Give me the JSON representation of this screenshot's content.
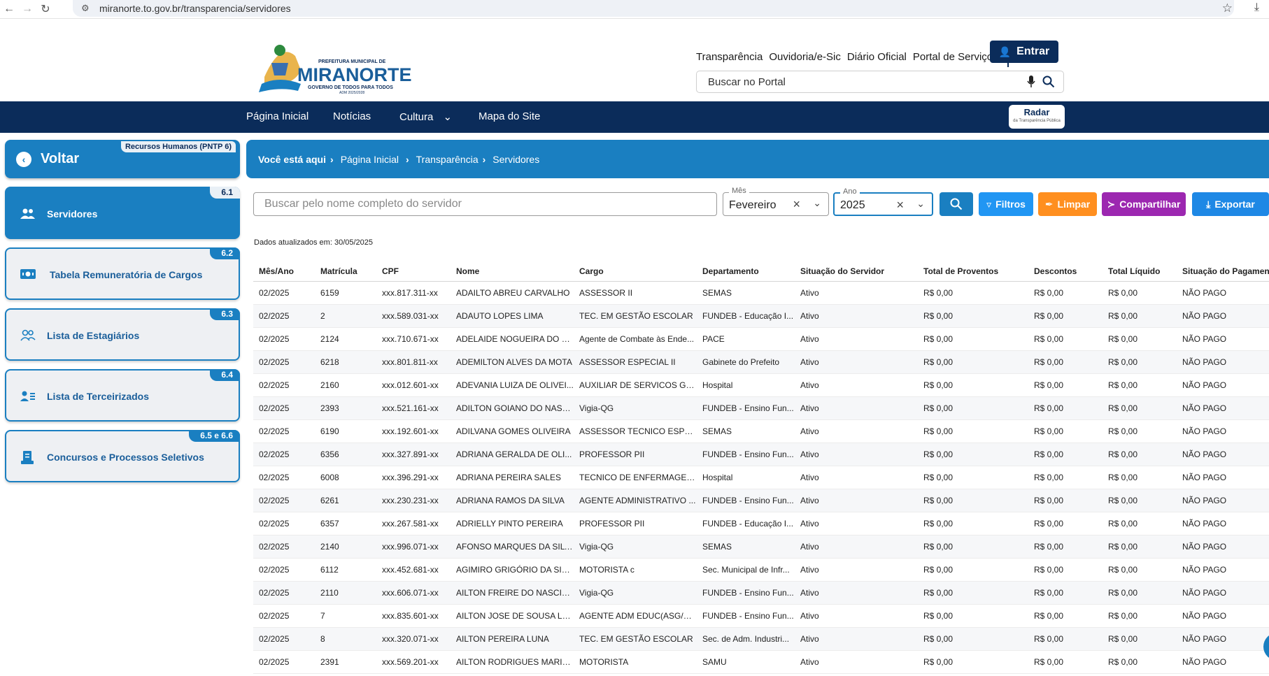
{
  "browser": {
    "url": "miranorte.to.gov.br/transparencia/servidores"
  },
  "header": {
    "logo_top": "PREFEITURA MUNICIPAL DE",
    "logo_name": "MIRANORTE",
    "logo_slogan": "GOVERNO DE TODOS PARA TODOS",
    "logo_adm": "ADM 2025/2028",
    "links": [
      "Transparência",
      "Ouvidoria/e-Sic",
      "Diário Oficial",
      "Portal de Serviços"
    ],
    "entrar_label": "Entrar",
    "search_placeholder": "Buscar no Portal"
  },
  "mainnav": {
    "items": [
      "Página Inicial",
      "Notícias",
      "Cultura",
      "Mapa do Site"
    ],
    "radar_title": "Radar",
    "radar_sub": "da Transparência Pública"
  },
  "sidebar": {
    "voltar_label": "Voltar",
    "voltar_tag": "Recursos Humanos (PNTP 6)",
    "items": [
      {
        "num": "6.1",
        "label": "Servidores",
        "active": true
      },
      {
        "num": "6.2",
        "label": "Tabela Remuneratória de Cargos",
        "active": false
      },
      {
        "num": "6.3",
        "label": "Lista de Estagiários",
        "active": false
      },
      {
        "num": "6.4",
        "label": "Lista de Terceirizados",
        "active": false
      },
      {
        "num": "6.5 e 6.6",
        "label": "Concursos e Processos Seletivos",
        "active": false
      }
    ]
  },
  "breadcrumb": {
    "prefix": "Você está aqui",
    "items": [
      "Página Inicial",
      "Transparência",
      "Servidores"
    ]
  },
  "filters": {
    "search_placeholder": "Buscar pelo nome completo do servidor",
    "mes_label": "Mês",
    "mes_value": "Fevereiro",
    "ano_label": "Ano",
    "ano_value": "2025",
    "btn_filtros": "Filtros",
    "btn_limpar": "Limpar",
    "btn_compartilhar": "Compartilhar",
    "btn_exportar": "Exportar",
    "colors": {
      "search": "#1a7fc1",
      "filtros": "#2196f3",
      "limpar": "#ff8f1f",
      "compartilhar": "#9c27b0",
      "exportar": "#1e88e5"
    }
  },
  "updated_text": "Dados atualizados em: 30/05/2025",
  "table": {
    "columns": [
      "Mês/Ano",
      "Matrícula",
      "CPF",
      "Nome",
      "Cargo",
      "Departamento",
      "Situação do Servidor",
      "Total de Proventos",
      "Descontos",
      "Total Líquido",
      "Situação do Pagamento"
    ],
    "rows": [
      [
        "02/2025",
        "6159",
        "xxx.817.311-xx",
        "ADAILTO ABREU CARVALHO",
        "ASSESSOR II",
        "SEMAS",
        "Ativo",
        "R$ 0,00",
        "R$ 0,00",
        "R$ 0,00",
        "NÃO PAGO"
      ],
      [
        "02/2025",
        "2",
        "xxx.589.031-xx",
        "ADAUTO LOPES LIMA",
        "TEC. EM GESTÃO ESCOLAR",
        "FUNDEB - Educação I...",
        "Ativo",
        "R$ 0,00",
        "R$ 0,00",
        "R$ 0,00",
        "NÃO PAGO"
      ],
      [
        "02/2025",
        "2124",
        "xxx.710.671-xx",
        "ADELAIDE NOGUEIRA DO N...",
        "Agente de Combate às Ende...",
        "PACE",
        "Ativo",
        "R$ 0,00",
        "R$ 0,00",
        "R$ 0,00",
        "NÃO PAGO"
      ],
      [
        "02/2025",
        "6218",
        "xxx.801.811-xx",
        "ADEMILTON ALVES DA MOTA",
        "ASSESSOR ESPECIAL II",
        "Gabinete do Prefeito",
        "Ativo",
        "R$ 0,00",
        "R$ 0,00",
        "R$ 0,00",
        "NÃO PAGO"
      ],
      [
        "02/2025",
        "2160",
        "xxx.012.601-xx",
        "ADEVANIA LUIZA DE OLIVEI...",
        "AUXILIAR DE SERVICOS GE...",
        "Hospital",
        "Ativo",
        "R$ 0,00",
        "R$ 0,00",
        "R$ 0,00",
        "NÃO PAGO"
      ],
      [
        "02/2025",
        "2393",
        "xxx.521.161-xx",
        "ADILTON GOIANO DO NASCI...",
        "Vigia-QG",
        "FUNDEB - Ensino Fun...",
        "Ativo",
        "R$ 0,00",
        "R$ 0,00",
        "R$ 0,00",
        "NÃO PAGO"
      ],
      [
        "02/2025",
        "6190",
        "xxx.192.601-xx",
        "ADILVANA GOMES OLIVEIRA",
        "ASSESSOR TECNICO ESPEC...",
        "SEMAS",
        "Ativo",
        "R$ 0,00",
        "R$ 0,00",
        "R$ 0,00",
        "NÃO PAGO"
      ],
      [
        "02/2025",
        "6356",
        "xxx.327.891-xx",
        "ADRIANA GERALDA DE OLI...",
        "PROFESSOR PII",
        "FUNDEB - Ensino Fun...",
        "Ativo",
        "R$ 0,00",
        "R$ 0,00",
        "R$ 0,00",
        "NÃO PAGO"
      ],
      [
        "02/2025",
        "6008",
        "xxx.396.291-xx",
        "ADRIANA PEREIRA SALES",
        "TECNICO DE ENFERMAGEM c",
        "Hospital",
        "Ativo",
        "R$ 0,00",
        "R$ 0,00",
        "R$ 0,00",
        "NÃO PAGO"
      ],
      [
        "02/2025",
        "6261",
        "xxx.230.231-xx",
        "ADRIANA RAMOS DA SILVA",
        "AGENTE ADMINISTRATIVO ...",
        "FUNDEB - Ensino Fun...",
        "Ativo",
        "R$ 0,00",
        "R$ 0,00",
        "R$ 0,00",
        "NÃO PAGO"
      ],
      [
        "02/2025",
        "6357",
        "xxx.267.581-xx",
        "ADRIELLY PINTO PEREIRA",
        "PROFESSOR PII",
        "FUNDEB - Educação I...",
        "Ativo",
        "R$ 0,00",
        "R$ 0,00",
        "R$ 0,00",
        "NÃO PAGO"
      ],
      [
        "02/2025",
        "2140",
        "xxx.996.071-xx",
        "AFONSO MARQUES DA SILVA",
        "Vigia-QG",
        "SEMAS",
        "Ativo",
        "R$ 0,00",
        "R$ 0,00",
        "R$ 0,00",
        "NÃO PAGO"
      ],
      [
        "02/2025",
        "6112",
        "xxx.452.681-xx",
        "AGIMIRO GRIGÓRIO DA SILVA",
        "MOTORISTA c",
        "Sec. Municipal de Infr...",
        "Ativo",
        "R$ 0,00",
        "R$ 0,00",
        "R$ 0,00",
        "NÃO PAGO"
      ],
      [
        "02/2025",
        "2110",
        "xxx.606.071-xx",
        "AILTON FREIRE DO NASCIM...",
        "Vigia-QG",
        "FUNDEB - Ensino Fun...",
        "Ativo",
        "R$ 0,00",
        "R$ 0,00",
        "R$ 0,00",
        "NÃO PAGO"
      ],
      [
        "02/2025",
        "7",
        "xxx.835.601-xx",
        "AILTON JOSE DE SOUSA LO...",
        "AGENTE ADM EDUC(ASG/VI...",
        "FUNDEB - Ensino Fun...",
        "Ativo",
        "R$ 0,00",
        "R$ 0,00",
        "R$ 0,00",
        "NÃO PAGO"
      ],
      [
        "02/2025",
        "8",
        "xxx.320.071-xx",
        "AILTON PEREIRA LUNA",
        "TEC. EM GESTÃO ESCOLAR",
        "Sec. de Adm. Industri...",
        "Ativo",
        "R$ 0,00",
        "R$ 0,00",
        "R$ 0,00",
        "NÃO PAGO"
      ],
      [
        "02/2025",
        "2391",
        "xxx.569.201-xx",
        "AILTON RODRIGUES MARIN...",
        "MOTORISTA",
        "SAMU",
        "Ativo",
        "R$ 0,00",
        "R$ 0,00",
        "R$ 0,00",
        "NÃO PAGO"
      ]
    ]
  }
}
